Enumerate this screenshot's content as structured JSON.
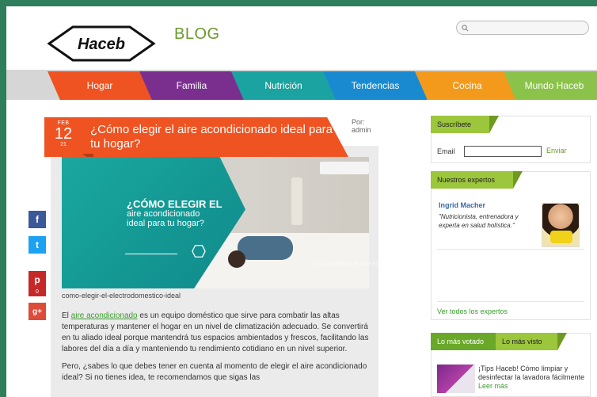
{
  "header": {
    "logo_text": "Haceb",
    "blog_title": "BLOG",
    "search_placeholder": ""
  },
  "nav": [
    {
      "label": "Hogar",
      "color": "#ef5322"
    },
    {
      "label": "Familia",
      "color": "#7a2f8f"
    },
    {
      "label": "Nutrición",
      "color": "#1aa3a0"
    },
    {
      "label": "Tendencias",
      "color": "#1a8ad0"
    },
    {
      "label": "Cocina",
      "color": "#f39a1c"
    },
    {
      "label": "Mundo Haceb",
      "color": "#8bc34a"
    }
  ],
  "article": {
    "date_month": "FEB",
    "date_day": "12",
    "date_year": "21",
    "title": "¿Cómo elegir el aire acondicionado ideal para tu hogar?",
    "author_label": "Por:",
    "author_name": "admin",
    "hero_line1": "¿CÓMO ELEGIR EL",
    "hero_line2": "aire acondicionado",
    "hero_line3": "ideal para tu hogar?",
    "hero_ghost_caption": "¿Cómo elegir el aire acondicionado ideal para tu hogar?",
    "image_caption": "como-elegir-el-electrodomestico-ideal",
    "p1_before": "El ",
    "p1_link": "aire acondicionado",
    "p1_after": " es un equipo doméstico que sirve para combatir las altas temperaturas y mantener el hogar en un nivel de climatización adecuado. Se convertirá en tu aliado ideal porque mantendrá tus espacios ambientados y frescos, facilitando las labores del día a día y manteniendo tu rendimiento cotidiano en un nivel superior.",
    "p2": "Pero, ¿sabes lo que debes tener en cuenta al momento de elegir el aire acondicionado ideal? Si no tienes idea, te recomendamos que sigas las"
  },
  "social": {
    "facebook": "f",
    "twitter": "t",
    "pinterest": "p",
    "pinterest_count": "0",
    "googleplus": "g+"
  },
  "sidebar": {
    "subscribe_tab": "Suscríbete",
    "email_label": "Email",
    "email_value": "",
    "send_label": "Enviar",
    "experts_tab": "Nuestros expertos",
    "expert_name": "Ingrid Macher",
    "expert_desc": "\"Nutricionista, entrenadora y experta en salud holística.\"",
    "all_experts": "Ver todos los expertos",
    "tab_voted": "Lo más votado",
    "tab_viewed": "Lo más visto",
    "post_title": "¡Tips Haceb! Cómo limpiar y desinfectar la lavadora fácilmente",
    "post_more": "Leer más"
  }
}
